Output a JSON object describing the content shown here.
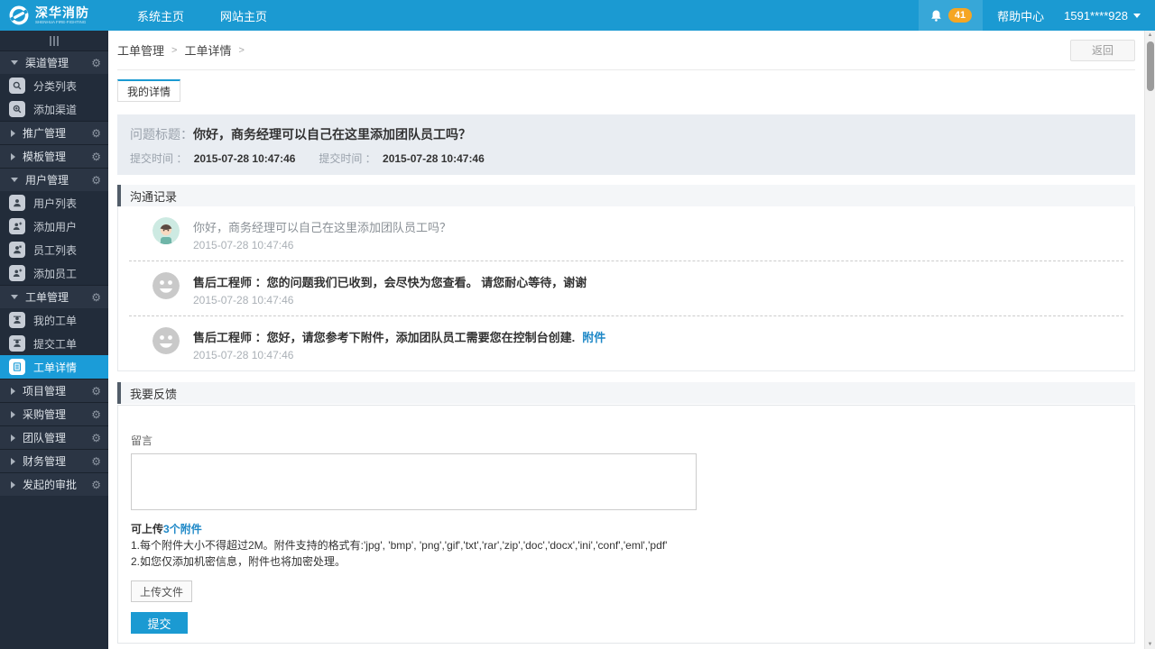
{
  "topbar": {
    "brand_name": "深华消防",
    "brand_subtitle": "SHENHUA FIRE-FIGHTING",
    "menu": [
      {
        "label": "系统主页"
      },
      {
        "label": "网站主页"
      }
    ],
    "notification_count": "41",
    "help_label": "帮助中心",
    "account_label": "1591****928"
  },
  "sidebar": {
    "items": [
      {
        "label": "渠道管理",
        "type": "parent",
        "state": "expanded"
      },
      {
        "label": "分类列表",
        "type": "child",
        "icon": "search-icon"
      },
      {
        "label": "添加渠道",
        "type": "child",
        "icon": "search-add-icon"
      },
      {
        "label": "推广管理",
        "type": "parent",
        "state": "collapsed"
      },
      {
        "label": "模板管理",
        "type": "parent",
        "state": "collapsed"
      },
      {
        "label": "用户管理",
        "type": "parent",
        "state": "expanded"
      },
      {
        "label": "用户列表",
        "type": "child",
        "icon": "user-icon"
      },
      {
        "label": "添加用户",
        "type": "child",
        "icon": "user-add-icon"
      },
      {
        "label": "员工列表",
        "type": "child",
        "icon": "staff-icon"
      },
      {
        "label": "添加员工",
        "type": "child",
        "icon": "staff-add-icon"
      },
      {
        "label": "工单管理",
        "type": "parent",
        "state": "expanded"
      },
      {
        "label": "我的工单",
        "type": "child",
        "icon": "ticket-icon"
      },
      {
        "label": "提交工单",
        "type": "child",
        "icon": "ticket-icon"
      },
      {
        "label": "工单详情",
        "type": "child",
        "icon": "document-icon",
        "active": true
      },
      {
        "label": "项目管理",
        "type": "parent",
        "state": "collapsed"
      },
      {
        "label": "采购管理",
        "type": "parent",
        "state": "collapsed"
      },
      {
        "label": "团队管理",
        "type": "parent",
        "state": "collapsed"
      },
      {
        "label": "财务管理",
        "type": "parent",
        "state": "collapsed"
      },
      {
        "label": "发起的审批",
        "type": "parent",
        "state": "collapsed"
      }
    ]
  },
  "breadcrumb": {
    "items": [
      "工单管理",
      "工单详情"
    ],
    "separator": ">"
  },
  "back_button_label": "返回",
  "tab_label": "我的详情",
  "ticket": {
    "title_label": "问题标题：",
    "title": "你好，商务经理可以自己在这里添加团队员工吗？",
    "submit_time_label": "提交时间 ：",
    "submit_time": "2015-07-28 10:47:46",
    "submit_time_label_2": "提交时间 ：",
    "submit_time_2": "2015-07-28 10:47:46"
  },
  "communication": {
    "header": "沟通记录",
    "messages": [
      {
        "sender": "customer",
        "text": "你好，商务经理可以自己在这里添加团队员工吗？",
        "time": "2015-07-28 10:47:46"
      },
      {
        "sender": "staff",
        "text": "售后工程师 ：您的问题我们已收到，会尽快为您查看。 请您耐心等待，谢谢",
        "time": "2015-07-28 10:47:46"
      },
      {
        "sender": "staff",
        "text": "售后工程师 ：您好，请您参考下附件，添加团队员工需要您在控制台创建.",
        "attachment_label": "附件",
        "time": "2015-07-28 10:47:46"
      }
    ]
  },
  "feedback": {
    "header": "我要反馈",
    "message_label": "留言",
    "message_value": "",
    "upload_hint_prefix": "可上传",
    "upload_hint_count": "3个附件",
    "rule1": "1.每个附件大小不得超过2M。附件支持的格式有:'jpg', 'bmp', 'png','gif','txt','rar','zip','doc','docx','ini','conf','eml','pdf'",
    "rule2": "2.如您仅添加机密信息，附件也将加密处理。",
    "upload_button_label": "上传文件",
    "submit_button_label": "提交"
  },
  "colors": {
    "accent": "#1b9ad2",
    "badge": "#f5a623",
    "sidebar_bg": "#222c3a",
    "active_item": "#1b9cd8",
    "link": "#1e88c7",
    "question_panel_bg": "#e9edf2",
    "section_accent": "#525d69"
  }
}
